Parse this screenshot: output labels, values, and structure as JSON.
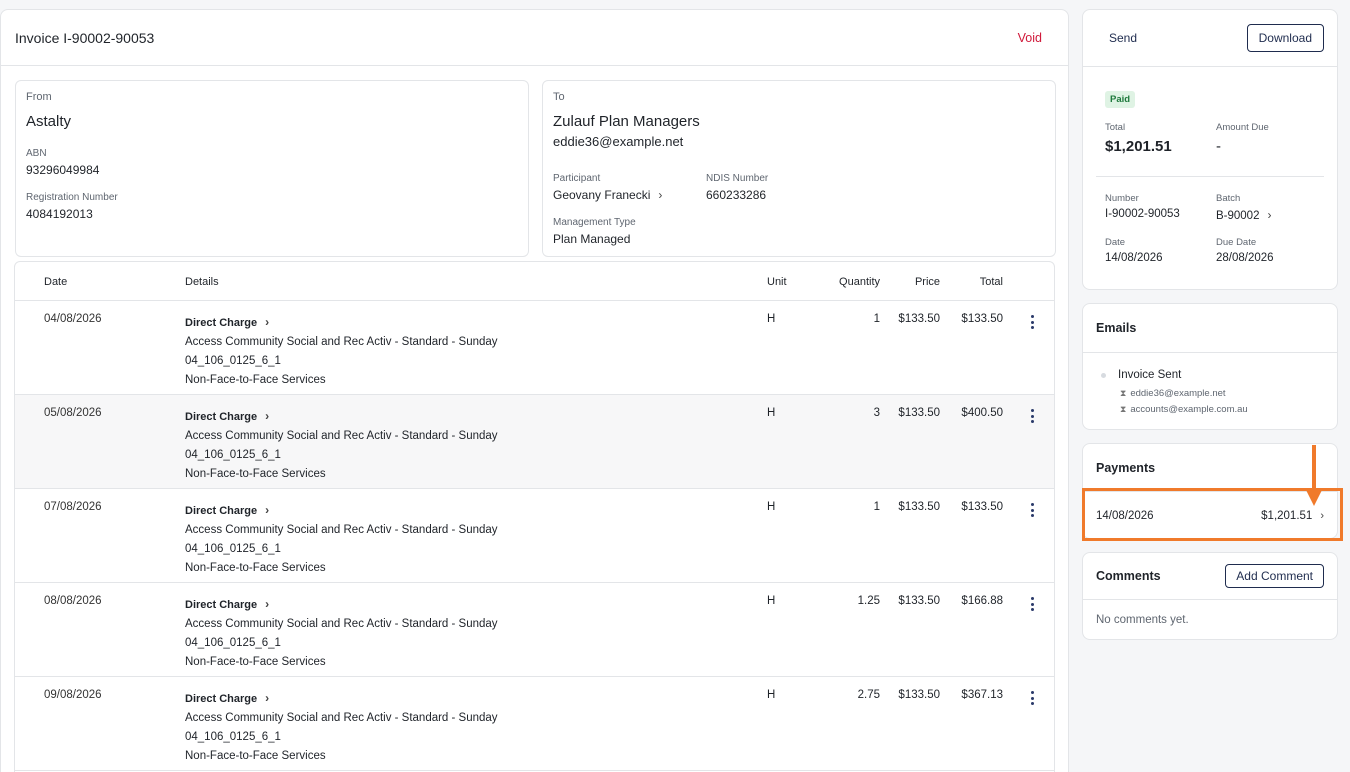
{
  "invoice": {
    "title": "Invoice I-90002-90053",
    "void_label": "Void"
  },
  "from": {
    "label": "From",
    "name": "Astalty",
    "abn_label": "ABN",
    "abn": "93296049984",
    "reg_label": "Registration Number",
    "reg": "4084192013"
  },
  "to": {
    "label": "To",
    "name": "Zulauf Plan Managers",
    "email": "eddie36@example.net",
    "participant_label": "Participant",
    "participant": "Geovany Franecki",
    "ndis_label": "NDIS Number",
    "ndis": "660233286",
    "mgmt_label": "Management Type",
    "mgmt": "Plan Managed"
  },
  "table": {
    "headers": {
      "date": "Date",
      "details": "Details",
      "unit": "Unit",
      "quantity": "Quantity",
      "price": "Price",
      "total": "Total"
    },
    "rows": [
      {
        "date": "04/08/2026",
        "title": "Direct Charge",
        "line1": "Access Community Social and Rec Activ - Standard - Sunday",
        "line2": "04_106_0125_6_1",
        "line3": "Non-Face-to-Face Services",
        "unit": "H",
        "qty": "1",
        "price": "$133.50",
        "total": "$133.50"
      },
      {
        "date": "05/08/2026",
        "title": "Direct Charge",
        "line1": "Access Community Social and Rec Activ - Standard - Sunday",
        "line2": "04_106_0125_6_1",
        "line3": "Non-Face-to-Face Services",
        "unit": "H",
        "qty": "3",
        "price": "$133.50",
        "total": "$400.50"
      },
      {
        "date": "07/08/2026",
        "title": "Direct Charge",
        "line1": "Access Community Social and Rec Activ - Standard - Sunday",
        "line2": "04_106_0125_6_1",
        "line3": "Non-Face-to-Face Services",
        "unit": "H",
        "qty": "1",
        "price": "$133.50",
        "total": "$133.50"
      },
      {
        "date": "08/08/2026",
        "title": "Direct Charge",
        "line1": "Access Community Social and Rec Activ - Standard - Sunday",
        "line2": "04_106_0125_6_1",
        "line3": "Non-Face-to-Face Services",
        "unit": "H",
        "qty": "1.25",
        "price": "$133.50",
        "total": "$166.88"
      },
      {
        "date": "09/08/2026",
        "title": "Direct Charge",
        "line1": "Access Community Social and Rec Activ - Standard - Sunday",
        "line2": "04_106_0125_6_1",
        "line3": "Non-Face-to-Face Services",
        "unit": "H",
        "qty": "2.75",
        "price": "$133.50",
        "total": "$367.13"
      }
    ]
  },
  "summary": {
    "send_label": "Send",
    "download_label": "Download",
    "status": "Paid",
    "total_label": "Total",
    "total": "$1,201.51",
    "amount_due_label": "Amount Due",
    "amount_due": "-",
    "number_label": "Number",
    "number": "I-90002-90053",
    "batch_label": "Batch",
    "batch": "B-90002",
    "date_label": "Date",
    "date": "14/08/2026",
    "due_label": "Due Date",
    "due": "28/08/2026"
  },
  "emails": {
    "title": "Emails",
    "item_title": "Invoice Sent",
    "recipients": [
      "eddie36@example.net",
      "accounts@example.com.au"
    ]
  },
  "payments": {
    "title": "Payments",
    "date": "14/08/2026",
    "amount": "$1,201.51"
  },
  "comments": {
    "title": "Comments",
    "add_label": "Add Comment",
    "empty": "No comments yet."
  },
  "colors": {
    "accent_highlight": "#f07a2b",
    "void": "#d0193a",
    "paid_bg": "#dff3e4"
  }
}
